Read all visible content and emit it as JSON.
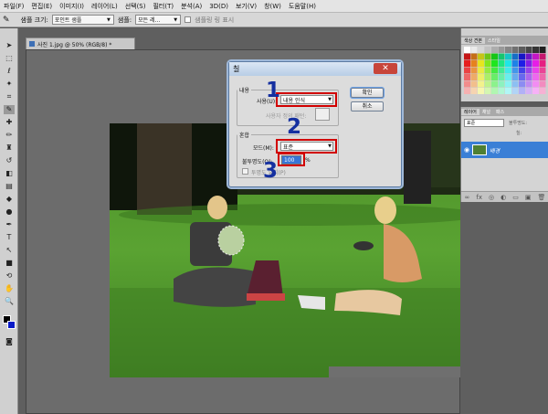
{
  "menubar": {
    "items": [
      "파일(F)",
      "편집(E)",
      "이미지(I)",
      "레이어(L)",
      "선택(S)",
      "필터(T)",
      "분석(A)",
      "3D(D)",
      "보기(V)",
      "창(W)",
      "도움말(H)"
    ]
  },
  "options": {
    "brush_size_label": "샘플 크기:",
    "brush_size_value": "포인트 샘플",
    "sample_label": "샘플:",
    "sample_value": "모든 레...",
    "checkbox_label": "샘플링 링 표시"
  },
  "document": {
    "tab_title": "사진 1.jpg @ 50% (RGB/8) *"
  },
  "dialog": {
    "title": "칠",
    "contents_legend": "내용",
    "use_label": "사용(U):",
    "use_value": "내용 인식",
    "custom_pattern_label": "사용자 정의 패턴:",
    "blend_legend": "혼합",
    "mode_label": "모드(M):",
    "mode_value": "표준",
    "opacity_label": "불투명도(O):",
    "opacity_value": "100",
    "opacity_unit": "%",
    "preserve_label": "투명도 유지(P)",
    "ok_label": "확인",
    "cancel_label": "취소"
  },
  "annotations": {
    "one": "1",
    "two": "2",
    "three": "3"
  },
  "swatches_panel": {
    "tabs": [
      "색상 견본",
      "스타일"
    ]
  },
  "layers_panel": {
    "tabs": [
      "레이어",
      "채널",
      "패스"
    ],
    "blend_mode": "표준",
    "opacity_label": "불투명도:",
    "fill_label": "칠:",
    "layer_name": "배경"
  },
  "colors": {
    "accent_red": "#d10000",
    "annotation_blue": "#1530a0",
    "selection_blue": "#3a7fd6"
  }
}
